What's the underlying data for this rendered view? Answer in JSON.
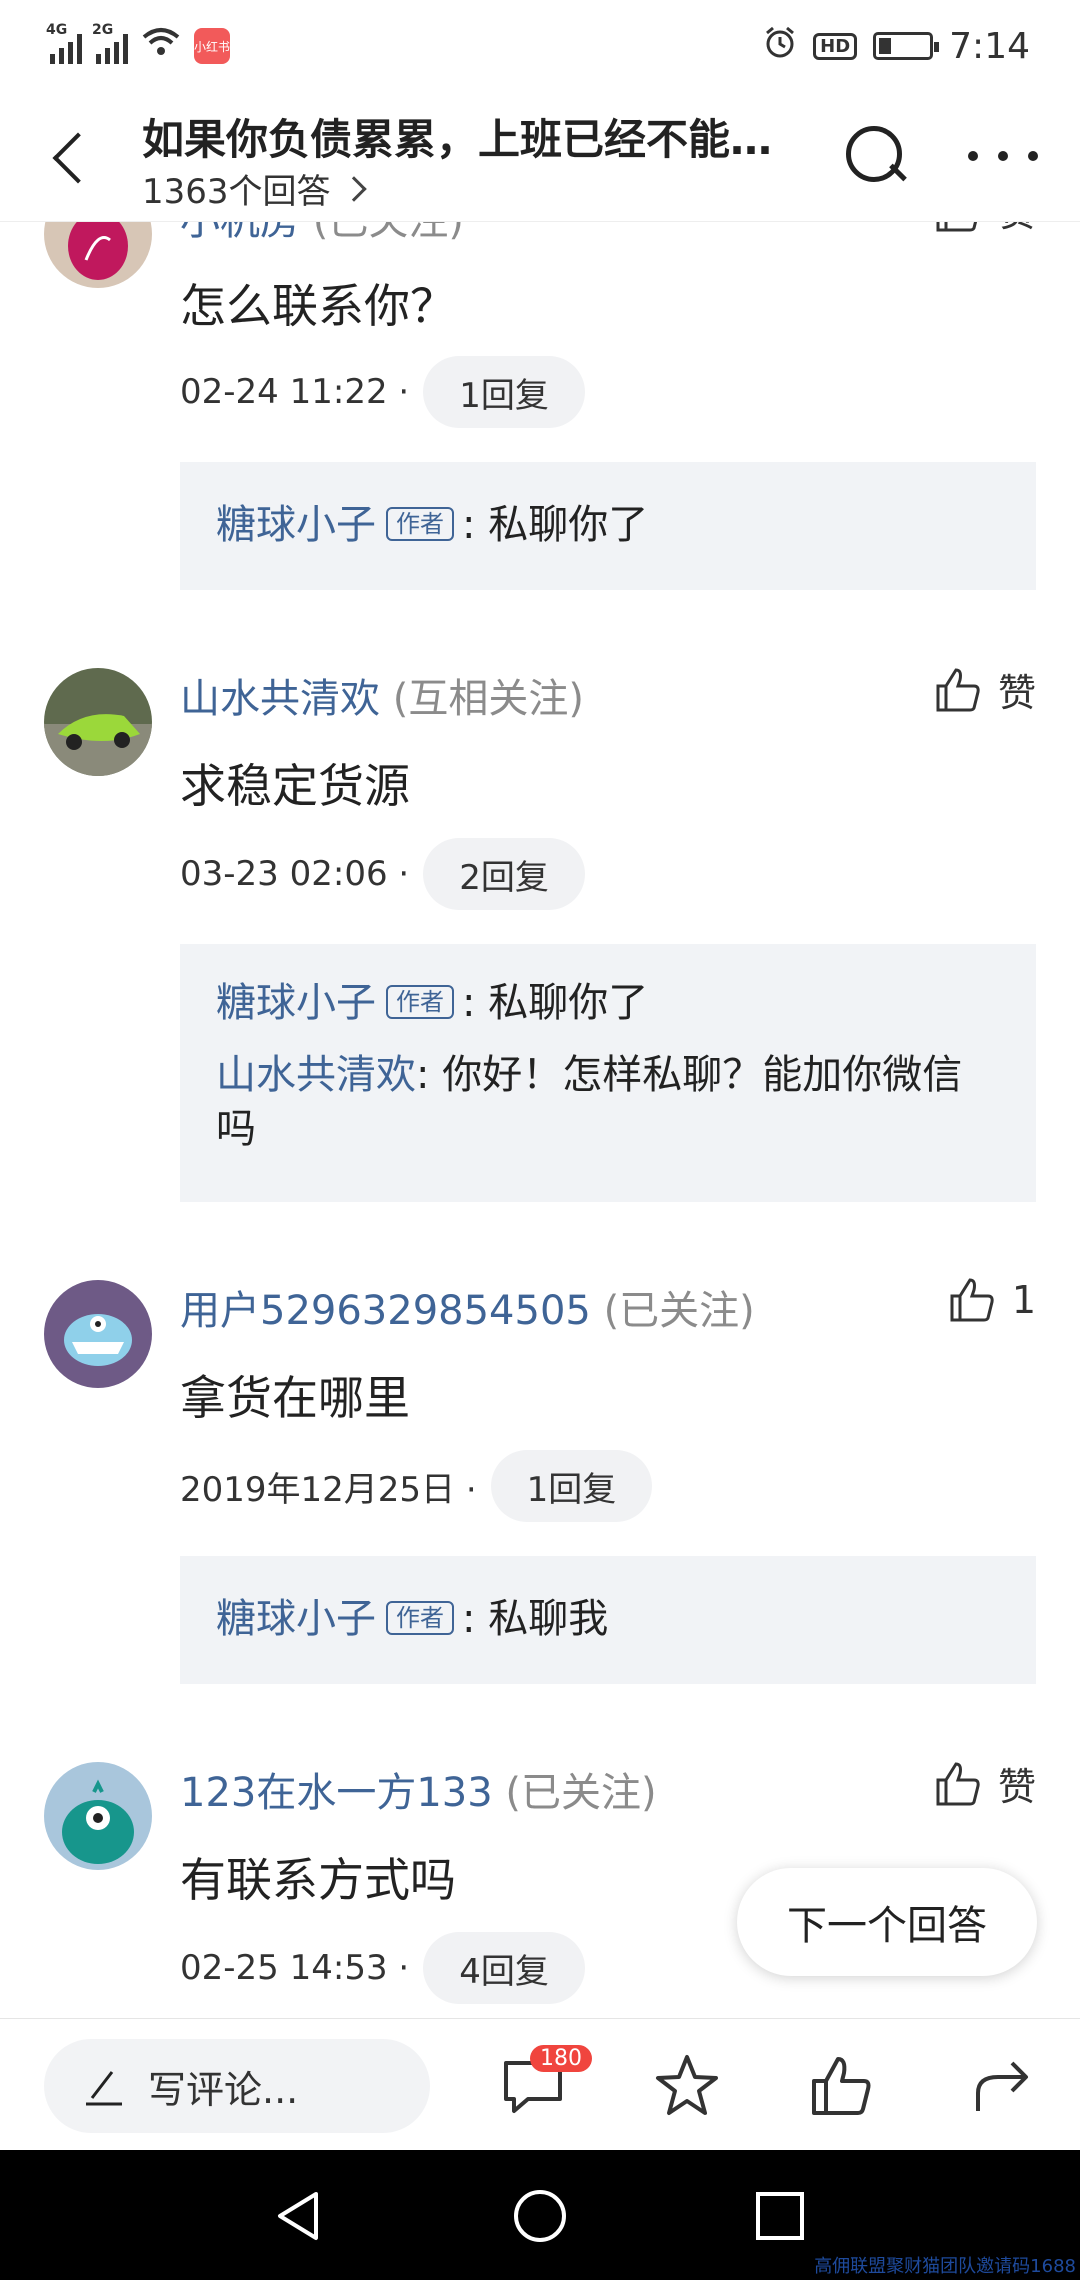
{
  "status_bar": {
    "signal1_label": "4G",
    "signal2_label": "2G",
    "app_badge": "小红书",
    "hd": "HD",
    "time": "7:14"
  },
  "header": {
    "title": "如果你负债累累，上班已经不能…",
    "answer_count": "1363个回答"
  },
  "comments": [
    {
      "name": "小机房",
      "relation": "(已关注)",
      "like": "赞",
      "text": "怎么联系你？",
      "time": "02-24 11:22 ·",
      "reply_count": "1回复",
      "replies": [
        {
          "name": "糖球小子",
          "author_tag": "作者",
          "text": ": 私聊你了"
        }
      ]
    },
    {
      "name": "山水共清欢",
      "relation": "(互相关注)",
      "like": "赞",
      "text": "求稳定货源",
      "time": "03-23 02:06 ·",
      "reply_count": "2回复",
      "replies": [
        {
          "name": "糖球小子",
          "author_tag": "作者",
          "text": ": 私聊你了"
        },
        {
          "name": "山水共清欢",
          "text": ": 你好！怎样私聊？能加你微信吗"
        }
      ]
    },
    {
      "name": "用户5296329854505",
      "relation": "(已关注)",
      "like": "1",
      "text": "拿货在哪里",
      "time": "2019年12月25日 ·",
      "reply_count": "1回复",
      "replies": [
        {
          "name": "糖球小子",
          "author_tag": "作者",
          "text": ": 私聊我"
        }
      ]
    },
    {
      "name": "123在水一方133",
      "relation": "(已关注)",
      "like": "赞",
      "text": "有联系方式吗",
      "time": "02-25 14:53 ·",
      "reply_count": "4回复"
    }
  ],
  "next_answer": "下一个回答",
  "bottom_bar": {
    "write_placeholder": "写评论...",
    "comment_badge": "180"
  },
  "watermark": "高佣联盟聚财猫团队邀请码1688",
  "colors": {
    "username": "#3f6496",
    "relation": "#8b8b8b",
    "reply_bg": "#f1f3f6",
    "badge": "#f0453e"
  }
}
